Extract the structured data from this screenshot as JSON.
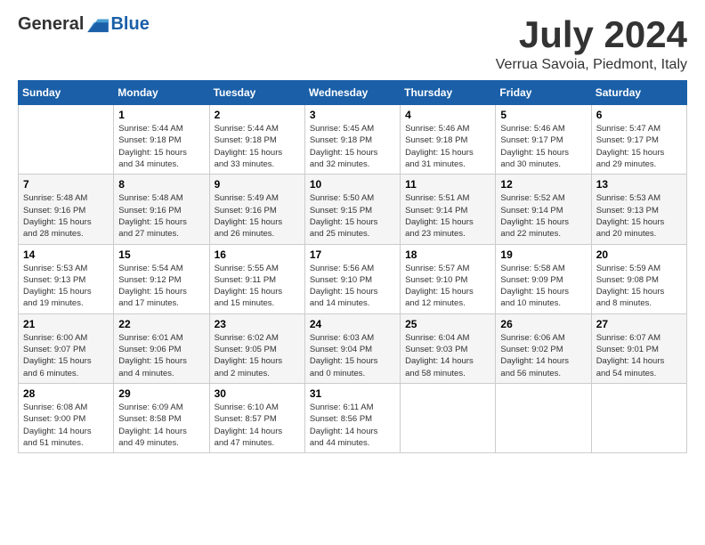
{
  "logo": {
    "general": "General",
    "blue": "Blue"
  },
  "header": {
    "month": "July 2024",
    "location": "Verrua Savoia, Piedmont, Italy"
  },
  "weekdays": [
    "Sunday",
    "Monday",
    "Tuesday",
    "Wednesday",
    "Thursday",
    "Friday",
    "Saturday"
  ],
  "weeks": [
    [
      {
        "day": "",
        "info": ""
      },
      {
        "day": "1",
        "info": "Sunrise: 5:44 AM\nSunset: 9:18 PM\nDaylight: 15 hours\nand 34 minutes."
      },
      {
        "day": "2",
        "info": "Sunrise: 5:44 AM\nSunset: 9:18 PM\nDaylight: 15 hours\nand 33 minutes."
      },
      {
        "day": "3",
        "info": "Sunrise: 5:45 AM\nSunset: 9:18 PM\nDaylight: 15 hours\nand 32 minutes."
      },
      {
        "day": "4",
        "info": "Sunrise: 5:46 AM\nSunset: 9:18 PM\nDaylight: 15 hours\nand 31 minutes."
      },
      {
        "day": "5",
        "info": "Sunrise: 5:46 AM\nSunset: 9:17 PM\nDaylight: 15 hours\nand 30 minutes."
      },
      {
        "day": "6",
        "info": "Sunrise: 5:47 AM\nSunset: 9:17 PM\nDaylight: 15 hours\nand 29 minutes."
      }
    ],
    [
      {
        "day": "7",
        "info": "Sunrise: 5:48 AM\nSunset: 9:16 PM\nDaylight: 15 hours\nand 28 minutes."
      },
      {
        "day": "8",
        "info": "Sunrise: 5:48 AM\nSunset: 9:16 PM\nDaylight: 15 hours\nand 27 minutes."
      },
      {
        "day": "9",
        "info": "Sunrise: 5:49 AM\nSunset: 9:16 PM\nDaylight: 15 hours\nand 26 minutes."
      },
      {
        "day": "10",
        "info": "Sunrise: 5:50 AM\nSunset: 9:15 PM\nDaylight: 15 hours\nand 25 minutes."
      },
      {
        "day": "11",
        "info": "Sunrise: 5:51 AM\nSunset: 9:14 PM\nDaylight: 15 hours\nand 23 minutes."
      },
      {
        "day": "12",
        "info": "Sunrise: 5:52 AM\nSunset: 9:14 PM\nDaylight: 15 hours\nand 22 minutes."
      },
      {
        "day": "13",
        "info": "Sunrise: 5:53 AM\nSunset: 9:13 PM\nDaylight: 15 hours\nand 20 minutes."
      }
    ],
    [
      {
        "day": "14",
        "info": "Sunrise: 5:53 AM\nSunset: 9:13 PM\nDaylight: 15 hours\nand 19 minutes."
      },
      {
        "day": "15",
        "info": "Sunrise: 5:54 AM\nSunset: 9:12 PM\nDaylight: 15 hours\nand 17 minutes."
      },
      {
        "day": "16",
        "info": "Sunrise: 5:55 AM\nSunset: 9:11 PM\nDaylight: 15 hours\nand 15 minutes."
      },
      {
        "day": "17",
        "info": "Sunrise: 5:56 AM\nSunset: 9:10 PM\nDaylight: 15 hours\nand 14 minutes."
      },
      {
        "day": "18",
        "info": "Sunrise: 5:57 AM\nSunset: 9:10 PM\nDaylight: 15 hours\nand 12 minutes."
      },
      {
        "day": "19",
        "info": "Sunrise: 5:58 AM\nSunset: 9:09 PM\nDaylight: 15 hours\nand 10 minutes."
      },
      {
        "day": "20",
        "info": "Sunrise: 5:59 AM\nSunset: 9:08 PM\nDaylight: 15 hours\nand 8 minutes."
      }
    ],
    [
      {
        "day": "21",
        "info": "Sunrise: 6:00 AM\nSunset: 9:07 PM\nDaylight: 15 hours\nand 6 minutes."
      },
      {
        "day": "22",
        "info": "Sunrise: 6:01 AM\nSunset: 9:06 PM\nDaylight: 15 hours\nand 4 minutes."
      },
      {
        "day": "23",
        "info": "Sunrise: 6:02 AM\nSunset: 9:05 PM\nDaylight: 15 hours\nand 2 minutes."
      },
      {
        "day": "24",
        "info": "Sunrise: 6:03 AM\nSunset: 9:04 PM\nDaylight: 15 hours\nand 0 minutes."
      },
      {
        "day": "25",
        "info": "Sunrise: 6:04 AM\nSunset: 9:03 PM\nDaylight: 14 hours\nand 58 minutes."
      },
      {
        "day": "26",
        "info": "Sunrise: 6:06 AM\nSunset: 9:02 PM\nDaylight: 14 hours\nand 56 minutes."
      },
      {
        "day": "27",
        "info": "Sunrise: 6:07 AM\nSunset: 9:01 PM\nDaylight: 14 hours\nand 54 minutes."
      }
    ],
    [
      {
        "day": "28",
        "info": "Sunrise: 6:08 AM\nSunset: 9:00 PM\nDaylight: 14 hours\nand 51 minutes."
      },
      {
        "day": "29",
        "info": "Sunrise: 6:09 AM\nSunset: 8:58 PM\nDaylight: 14 hours\nand 49 minutes."
      },
      {
        "day": "30",
        "info": "Sunrise: 6:10 AM\nSunset: 8:57 PM\nDaylight: 14 hours\nand 47 minutes."
      },
      {
        "day": "31",
        "info": "Sunrise: 6:11 AM\nSunset: 8:56 PM\nDaylight: 14 hours\nand 44 minutes."
      },
      {
        "day": "",
        "info": ""
      },
      {
        "day": "",
        "info": ""
      },
      {
        "day": "",
        "info": ""
      }
    ]
  ]
}
